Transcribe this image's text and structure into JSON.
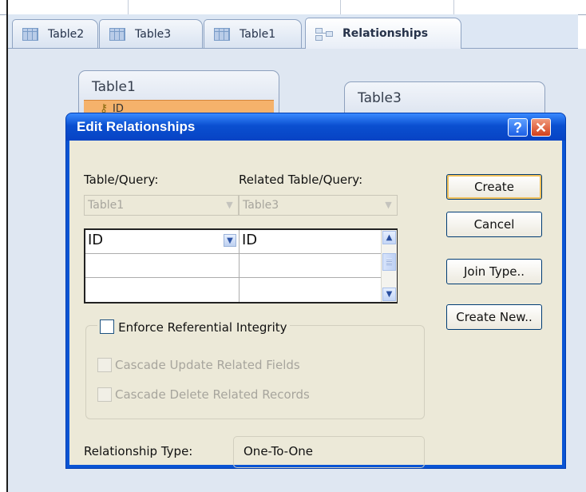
{
  "tabs": [
    {
      "label": "Table2",
      "icon": "table-icon"
    },
    {
      "label": "Table3",
      "icon": "table-icon"
    },
    {
      "label": "Table1",
      "icon": "table-icon"
    },
    {
      "label": "Relationships",
      "icon": "relationships-icon",
      "active": true
    }
  ],
  "canvas": {
    "table1": {
      "title": "Table1",
      "field": "ID"
    },
    "table3": {
      "title": "Table3"
    }
  },
  "dialog": {
    "title": "Edit Relationships",
    "help_label": "?",
    "close_label": "✕",
    "table_query_label": "Table/Query:",
    "related_query_label": "Related Table/Query:",
    "table_value": "Table1",
    "related_value": "Table3",
    "grid_rows": [
      {
        "left": "ID",
        "right": "ID"
      },
      {
        "left": "",
        "right": ""
      },
      {
        "left": "",
        "right": ""
      }
    ],
    "buttons": {
      "create": "Create",
      "cancel": "Cancel",
      "join_type": "Join Type..",
      "create_new": "Create New.."
    },
    "enforce_label": "Enforce Referential Integrity",
    "cascade_update_label": "Cascade Update Related Fields",
    "cascade_delete_label": "Cascade Delete Related Records",
    "relationship_type_label": "Relationship Type:",
    "relationship_type_value": "One-To-One"
  },
  "colors": {
    "title_bar": "#0a54d4",
    "dialog_body": "#ece9d8",
    "canvas": "#dfe7f2",
    "table_field_highlight": "#f5b26b",
    "focus_ring": "#f2c25c"
  }
}
